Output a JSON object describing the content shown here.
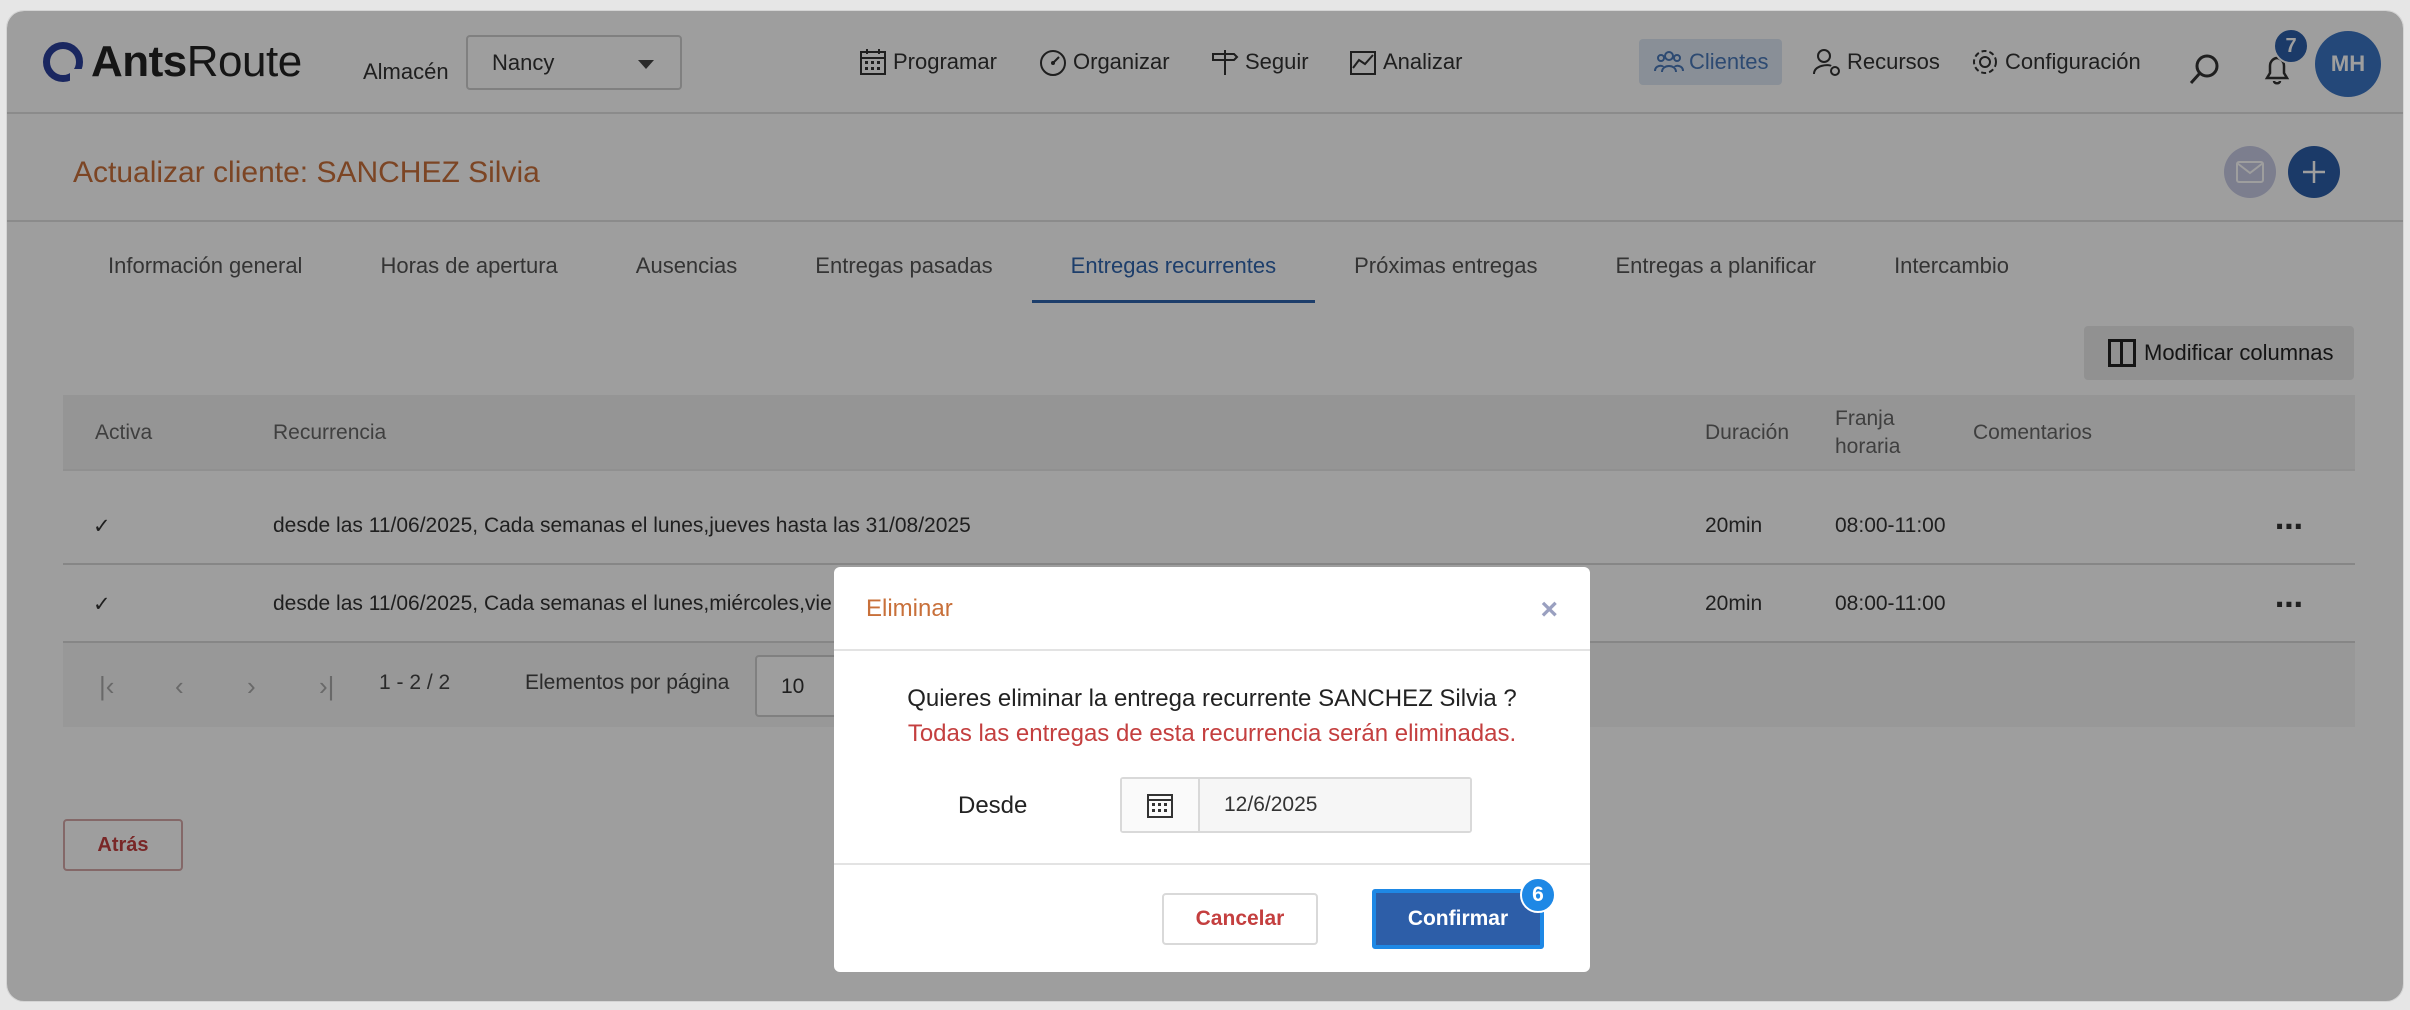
{
  "app": {
    "logo_bold": "Ants",
    "logo_regular": "Route"
  },
  "header": {
    "warehouse_label": "Almacén",
    "warehouse_value": "Nancy",
    "nav": {
      "programar": "Programar",
      "organizar": "Organizar",
      "seguir": "Seguir",
      "analizar": "Analizar",
      "clientes": "Clientes",
      "recursos": "Recursos",
      "configuracion": "Configuración"
    },
    "notifications_count": "7",
    "avatar_initials": "MH"
  },
  "page": {
    "title": "Actualizar cliente: SANCHEZ Silvia"
  },
  "tabs": [
    {
      "label": "Información general"
    },
    {
      "label": "Horas de apertura"
    },
    {
      "label": "Ausencias"
    },
    {
      "label": "Entregas pasadas"
    },
    {
      "label": "Entregas recurrentes",
      "active": true
    },
    {
      "label": "Próximas entregas"
    },
    {
      "label": "Entregas a planificar"
    },
    {
      "label": "Intercambio"
    }
  ],
  "toolbar": {
    "modify_columns": "Modificar columnas"
  },
  "table": {
    "headers": {
      "activa": "Activa",
      "recurrencia": "Recurrencia",
      "duracion": "Duración",
      "franja_1": "Franja",
      "franja_2": "horaria",
      "comentarios": "Comentarios"
    },
    "rows": [
      {
        "active": "✓",
        "recurrence": "desde las 11/06/2025, Cada semanas el lunes,jueves hasta las 31/08/2025",
        "duration": "20min",
        "slot": "08:00-11:00",
        "comments": ""
      },
      {
        "active": "✓",
        "recurrence": "desde las 11/06/2025, Cada semanas el lunes,miércoles,vie",
        "duration": "20min",
        "slot": "08:00-11:00",
        "comments": ""
      }
    ],
    "pager": {
      "range": "1 - 2 / 2",
      "per_page_label": "Elementos por página",
      "per_page_value": "10"
    }
  },
  "footer": {
    "back": "Atrás"
  },
  "modal": {
    "title": "Eliminar",
    "question": "Quieres eliminar la entrega recurrente SANCHEZ Silvia ?",
    "warning": "Todas las entregas de esta recurrencia serán eliminadas.",
    "from_label": "Desde",
    "from_value": "12/6/2025",
    "cancel": "Cancelar",
    "confirm": "Confirmar",
    "confirm_badge": "6"
  },
  "colors": {
    "accent": "#2d5ea8",
    "title_orange": "#c8703a",
    "danger": "#c43f3f"
  }
}
